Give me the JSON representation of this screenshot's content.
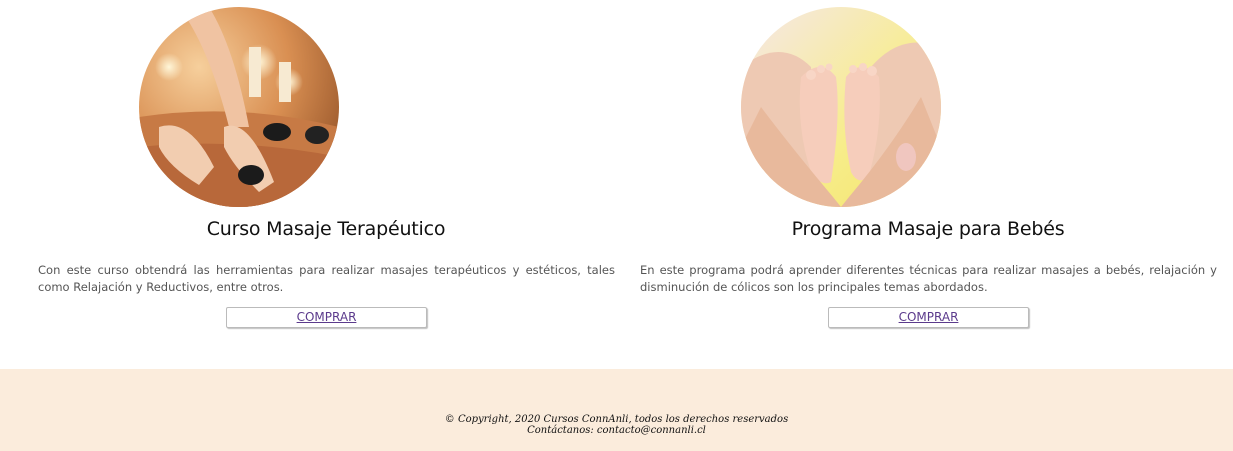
{
  "courses": [
    {
      "title": "Curso Masaje Terapéutico",
      "description": "Con este curso obtendrá las herramientas para realizar masajes terapéuticos y estéticos, tales como Relajación y Reductivos, entre otros.",
      "button_label": "COMPRAR",
      "image": "hot-stone-massage-photo"
    },
    {
      "title": "Programa Masaje para Bebés",
      "description": "En este programa podrá aprender diferentes técnicas para realizar masajes a bebés, relajación y disminución de cólicos son los principales temas abordados.",
      "button_label": "COMPRAR",
      "image": "baby-feet-massage-photo"
    }
  ],
  "footer": {
    "copyright": "© Copyright, 2020 Cursos ConnAnli, todos los derechos reservados",
    "contact": "Contáctanos: contacto@connanli.cl",
    "background": "#fbecdc"
  },
  "colors": {
    "button_text": "#5b3a8c"
  }
}
